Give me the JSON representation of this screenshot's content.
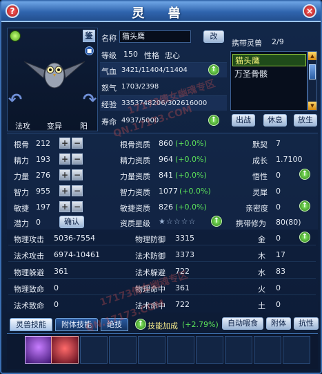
{
  "window": {
    "title": "灵 兽",
    "help_btn": "?",
    "close_btn": "×"
  },
  "watermarks": [
    "17173倩女幽魂专区",
    "QN.17173.COM",
    "17173倩女幽魂专区",
    "QN.17173.COM"
  ],
  "portrait": {
    "jian_btn": "鉴",
    "labels": [
      "法攻",
      "变异",
      "阳"
    ]
  },
  "info": {
    "name_label": "名称",
    "name_value": "猫头鹰",
    "rename_btn": "改",
    "level_label": "等级",
    "level_value": "150",
    "nature_label": "性格",
    "nature_value": "忠心",
    "hp_label": "气血",
    "hp_value": "3421/11404/11404",
    "anger_label": "怒气",
    "anger_value": "1703/2398",
    "exp_label": "经验",
    "exp_value": "3353748206/302616000",
    "life_label": "寿命",
    "life_value": "4937/5000"
  },
  "carry": {
    "label": "携带灵兽",
    "count": "2/9",
    "items": [
      "猫头鹰",
      "万圣骨骸"
    ],
    "buttons": [
      "出战",
      "休息",
      "放生"
    ]
  },
  "attributes": {
    "rows": [
      {
        "name": "根骨",
        "value": "212",
        "apt_name": "根骨资质",
        "apt_value": "860",
        "apt_pct": "(+0.0%)",
        "right_name": "默契",
        "right_value": "7"
      },
      {
        "name": "精力",
        "value": "193",
        "apt_name": "精力资质",
        "apt_value": "964",
        "apt_pct": "(+0.0%)",
        "right_name": "成长",
        "right_value": "1.7100"
      },
      {
        "name": "力量",
        "value": "276",
        "apt_name": "力量资质",
        "apt_value": "841",
        "apt_pct": "(+0.0%)",
        "right_name": "悟性",
        "right_value": "0"
      },
      {
        "name": "智力",
        "value": "955",
        "apt_name": "智力资质",
        "apt_value": "1077",
        "apt_pct": "(+0.0%)",
        "right_name": "灵犀",
        "right_value": "0"
      },
      {
        "name": "敏捷",
        "value": "197",
        "apt_name": "敏捷资质",
        "apt_value": "826",
        "apt_pct": "(+0.0%)",
        "right_name": "亲密度",
        "right_value": "0"
      }
    ],
    "potential_label": "潜力",
    "potential_value": "0",
    "confirm_btn": "确认",
    "star_label": "资质星级",
    "stars": "★☆☆☆☆",
    "carry_cultivation_label": "携带修为",
    "carry_cultivation_value": "80(80)"
  },
  "combat": {
    "rows": [
      {
        "l_name": "物理攻击",
        "l_value": "5036-7554",
        "r_name": "物理防御",
        "r_value": "3315",
        "e_name": "金",
        "e_value": "0"
      },
      {
        "l_name": "法术攻击",
        "l_value": "6974-10461",
        "r_name": "法术防御",
        "r_value": "3373",
        "e_name": "木",
        "e_value": "17"
      },
      {
        "l_name": "物理躲避",
        "l_value": "361",
        "r_name": "法术躲避",
        "r_value": "722",
        "e_name": "水",
        "e_value": "83"
      },
      {
        "l_name": "物理致命",
        "l_value": "0",
        "r_name": "物理命中",
        "r_value": "361",
        "e_name": "火",
        "e_value": "0"
      },
      {
        "l_name": "法术致命",
        "l_value": "0",
        "r_name": "法术命中",
        "r_value": "722",
        "e_name": "土",
        "e_value": "0"
      }
    ]
  },
  "tabs": {
    "items": [
      "灵兽技能",
      "附体技能",
      "绝技"
    ],
    "skill_bonus_label": "技能加成",
    "skill_bonus_value": "(+2.79%)",
    "right_buttons": [
      "自动喂食",
      "附体",
      "抗性"
    ]
  }
}
